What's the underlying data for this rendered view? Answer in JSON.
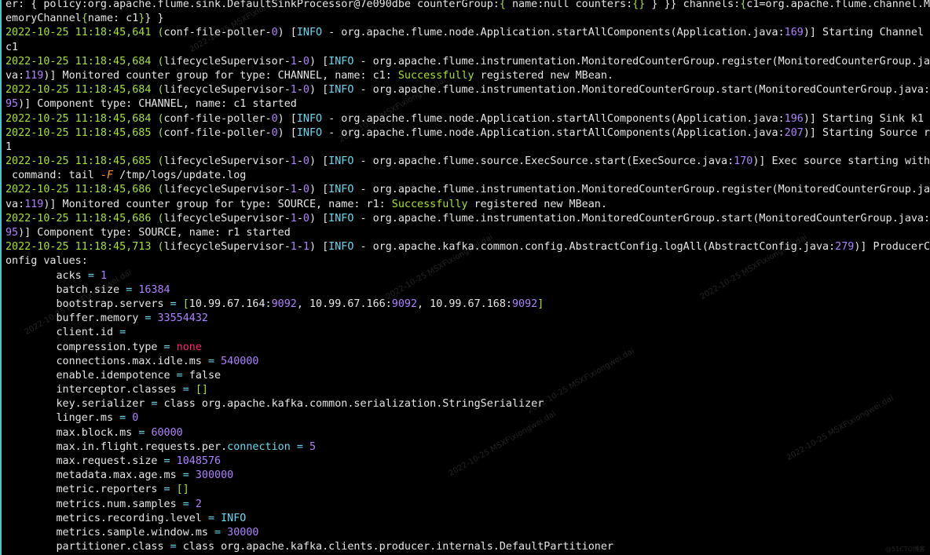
{
  "terminal": {
    "lines": [
      [
        [
          "er: { policy:org.apache.flume.sink.DefaultSinkProcessor@7e090dbe counterGroup:",
          "w"
        ],
        [
          "{",
          "g"
        ],
        [
          " name:null counters:",
          "w"
        ],
        [
          "{}",
          "g"
        ],
        [
          " } }} channels:",
          "w"
        ],
        [
          "{",
          "g"
        ],
        [
          "c1=org.apache.flume.channel.M",
          "w"
        ]
      ],
      [
        [
          "emoryChannel",
          "w"
        ],
        [
          "{",
          "g"
        ],
        [
          "name: c1",
          "w"
        ],
        [
          "}",
          "g"
        ],
        [
          "} }",
          "w"
        ]
      ],
      [
        [
          "2022-10-25 11:18:45,641 ",
          "g"
        ],
        [
          "(",
          "g"
        ],
        [
          "conf-file-poller-",
          "w"
        ],
        [
          "0",
          "p"
        ],
        [
          ") [",
          "w"
        ],
        [
          "INFO",
          "b"
        ],
        [
          " - org.apache.flume.node.Application.startAllComponents(",
          "w"
        ],
        [
          "Application.java:",
          "w"
        ],
        [
          "169",
          "p"
        ],
        [
          ")] Starting Channel",
          "w"
        ]
      ],
      [
        [
          "c1",
          "w"
        ]
      ],
      [
        [
          "2022-10-25 11:18:45,684 ",
          "g"
        ],
        [
          "(",
          "g"
        ],
        [
          "lifecycleSupervisor-",
          "w"
        ],
        [
          "1",
          "p"
        ],
        [
          "-",
          "w"
        ],
        [
          "0",
          "p"
        ],
        [
          ") [",
          "w"
        ],
        [
          "INFO",
          "b"
        ],
        [
          " - org.apache.flume.instrumentation.MonitoredCounterGroup.register(",
          "w"
        ],
        [
          "MonitoredCounterGroup.ja",
          "w"
        ]
      ],
      [
        [
          "va:",
          "w"
        ],
        [
          "119",
          "p"
        ],
        [
          ")] Monitored counter group for type: CHANNEL, name: c1: ",
          "w"
        ],
        [
          "Successfully",
          "s"
        ],
        [
          " registered new MBean.",
          "w"
        ]
      ],
      [
        [
          "2022-10-25 11:18:45,684 ",
          "g"
        ],
        [
          "(",
          "g"
        ],
        [
          "lifecycleSupervisor-",
          "w"
        ],
        [
          "1",
          "p"
        ],
        [
          "-",
          "w"
        ],
        [
          "0",
          "p"
        ],
        [
          ") [",
          "w"
        ],
        [
          "INFO",
          "b"
        ],
        [
          " - org.apache.flume.instrumentation.MonitoredCounterGroup.start(",
          "w"
        ],
        [
          "MonitoredCounterGroup.java:",
          "w"
        ]
      ],
      [
        [
          "95",
          "p"
        ],
        [
          ")] Component type: CHANNEL, name: c1 started",
          "w"
        ]
      ],
      [
        [
          "2022-10-25 11:18:45,684 ",
          "g"
        ],
        [
          "(",
          "g"
        ],
        [
          "conf-file-poller-",
          "w"
        ],
        [
          "0",
          "p"
        ],
        [
          ") [",
          "w"
        ],
        [
          "INFO",
          "b"
        ],
        [
          " - org.apache.flume.node.Application.startAllComponents(",
          "w"
        ],
        [
          "Application.java:",
          "w"
        ],
        [
          "196",
          "p"
        ],
        [
          ")] Starting Sink k1",
          "w"
        ]
      ],
      [
        [
          "2022-10-25 11:18:45,685 ",
          "g"
        ],
        [
          "(",
          "g"
        ],
        [
          "conf-file-poller-",
          "w"
        ],
        [
          "0",
          "p"
        ],
        [
          ") [",
          "w"
        ],
        [
          "INFO",
          "b"
        ],
        [
          " - org.apache.flume.node.Application.startAllComponents(",
          "w"
        ],
        [
          "Application.java:",
          "w"
        ],
        [
          "207",
          "p"
        ],
        [
          ")] Starting Source r",
          "w"
        ]
      ],
      [
        [
          "1",
          "w"
        ]
      ],
      [
        [
          "2022-10-25 11:18:45,685 ",
          "g"
        ],
        [
          "(",
          "g"
        ],
        [
          "lifecycleSupervisor-",
          "w"
        ],
        [
          "1",
          "p"
        ],
        [
          "-",
          "w"
        ],
        [
          "0",
          "p"
        ],
        [
          ") [",
          "w"
        ],
        [
          "INFO",
          "b"
        ],
        [
          " - org.apache.flume.source.ExecSource.start(",
          "w"
        ],
        [
          "ExecSource.java:",
          "w"
        ],
        [
          "170",
          "p"
        ],
        [
          ")] Exec source starting with",
          "w"
        ]
      ],
      [
        [
          " command: tail ",
          "w"
        ],
        [
          "-F",
          "o"
        ],
        [
          " /tmp/logs/update.log",
          "w"
        ]
      ],
      [
        [
          "2022-10-25 11:18:45,686 ",
          "g"
        ],
        [
          "(",
          "g"
        ],
        [
          "lifecycleSupervisor-",
          "w"
        ],
        [
          "1",
          "p"
        ],
        [
          "-",
          "w"
        ],
        [
          "0",
          "p"
        ],
        [
          ") [",
          "w"
        ],
        [
          "INFO",
          "b"
        ],
        [
          " - org.apache.flume.instrumentation.MonitoredCounterGroup.register(",
          "w"
        ],
        [
          "MonitoredCounterGroup.ja",
          "w"
        ]
      ],
      [
        [
          "va:",
          "w"
        ],
        [
          "119",
          "p"
        ],
        [
          ")] Monitored counter group for type: SOURCE, name: r1: ",
          "w"
        ],
        [
          "Successfully",
          "s"
        ],
        [
          " registered new MBean.",
          "w"
        ]
      ],
      [
        [
          "2022-10-25 11:18:45,686 ",
          "g"
        ],
        [
          "(",
          "g"
        ],
        [
          "lifecycleSupervisor-",
          "w"
        ],
        [
          "1",
          "p"
        ],
        [
          "-",
          "w"
        ],
        [
          "0",
          "p"
        ],
        [
          ") [",
          "w"
        ],
        [
          "INFO",
          "b"
        ],
        [
          " - org.apache.flume.instrumentation.MonitoredCounterGroup.start(",
          "w"
        ],
        [
          "MonitoredCounterGroup.java:",
          "w"
        ]
      ],
      [
        [
          "95",
          "p"
        ],
        [
          ")] Component type: SOURCE, name: r1 started",
          "w"
        ]
      ],
      [
        [
          "2022-10-25 11:18:45,713 ",
          "g"
        ],
        [
          "(",
          "g"
        ],
        [
          "lifecycleSupervisor-",
          "w"
        ],
        [
          "1",
          "p"
        ],
        [
          "-",
          "w"
        ],
        [
          "1",
          "p"
        ],
        [
          ") [",
          "w"
        ],
        [
          "INFO",
          "b"
        ],
        [
          " - org.apache.kafka.common.config.AbstractConfig.logAll(",
          "w"
        ],
        [
          "AbstractConfig.java:",
          "w"
        ],
        [
          "279",
          "p"
        ],
        [
          ")] ProducerC",
          "w"
        ]
      ],
      [
        [
          "onfig values:",
          "w"
        ]
      ],
      [
        [
          "        acks ",
          "w"
        ],
        [
          "=",
          "b"
        ],
        [
          " ",
          "w"
        ],
        [
          "1",
          "p"
        ]
      ],
      [
        [
          "        batch.size ",
          "w"
        ],
        [
          "=",
          "b"
        ],
        [
          " ",
          "w"
        ],
        [
          "16384",
          "p"
        ]
      ],
      [
        [
          "        bootstrap.servers ",
          "w"
        ],
        [
          "=",
          "b"
        ],
        [
          " [",
          "g"
        ],
        [
          "10.99.67.164:",
          "w"
        ],
        [
          "9092",
          "p"
        ],
        [
          ", ",
          "w"
        ],
        [
          "10.99.67.166:",
          "w"
        ],
        [
          "9092",
          "p"
        ],
        [
          ", ",
          "w"
        ],
        [
          "10.99.67.168:",
          "w"
        ],
        [
          "9092",
          "p"
        ],
        [
          "]",
          "g"
        ]
      ],
      [
        [
          "        buffer.memory ",
          "w"
        ],
        [
          "=",
          "b"
        ],
        [
          " ",
          "w"
        ],
        [
          "33554432",
          "p"
        ]
      ],
      [
        [
          "        client.id ",
          "w"
        ],
        [
          "=",
          "b"
        ]
      ],
      [
        [
          "        compression.type ",
          "w"
        ],
        [
          "=",
          "b"
        ],
        [
          " ",
          "w"
        ],
        [
          "none",
          "r"
        ]
      ],
      [
        [
          "        connections.max.idle.ms ",
          "w"
        ],
        [
          "=",
          "b"
        ],
        [
          " ",
          "w"
        ],
        [
          "540000",
          "p"
        ]
      ],
      [
        [
          "        enable.idempotence ",
          "w"
        ],
        [
          "=",
          "b"
        ],
        [
          " false",
          "w"
        ]
      ],
      [
        [
          "        interceptor.classes ",
          "w"
        ],
        [
          "=",
          "b"
        ],
        [
          " ",
          "w"
        ],
        [
          "[]",
          "g"
        ]
      ],
      [
        [
          "        key.serializer ",
          "w"
        ],
        [
          "=",
          "b"
        ],
        [
          " class org.apache.kafka.common.serialization.StringSerializer",
          "w"
        ]
      ],
      [
        [
          "        linger.ms ",
          "w"
        ],
        [
          "=",
          "b"
        ],
        [
          " ",
          "w"
        ],
        [
          "0",
          "p"
        ]
      ],
      [
        [
          "        max.block.ms ",
          "w"
        ],
        [
          "=",
          "b"
        ],
        [
          " ",
          "w"
        ],
        [
          "60000",
          "p"
        ]
      ],
      [
        [
          "        max.in.flight.requests.per.",
          "w"
        ],
        [
          "connection",
          "b"
        ],
        [
          " ",
          "w"
        ],
        [
          "=",
          "b"
        ],
        [
          " ",
          "w"
        ],
        [
          "5",
          "p"
        ]
      ],
      [
        [
          "        max.request.size ",
          "w"
        ],
        [
          "=",
          "b"
        ],
        [
          " ",
          "w"
        ],
        [
          "1048576",
          "p"
        ]
      ],
      [
        [
          "        metadata.max.age.ms ",
          "w"
        ],
        [
          "=",
          "b"
        ],
        [
          " ",
          "w"
        ],
        [
          "300000",
          "p"
        ]
      ],
      [
        [
          "        metric.reporters ",
          "w"
        ],
        [
          "=",
          "b"
        ],
        [
          " ",
          "w"
        ],
        [
          "[]",
          "g"
        ]
      ],
      [
        [
          "        metrics.num.samples ",
          "w"
        ],
        [
          "=",
          "b"
        ],
        [
          " ",
          "w"
        ],
        [
          "2",
          "p"
        ]
      ],
      [
        [
          "        metrics.recording.level ",
          "w"
        ],
        [
          "=",
          "b"
        ],
        [
          " ",
          "w"
        ],
        [
          "INFO",
          "b"
        ]
      ],
      [
        [
          "        metrics.sample.window.ms ",
          "w"
        ],
        [
          "=",
          "b"
        ],
        [
          " ",
          "w"
        ],
        [
          "30000",
          "p"
        ]
      ],
      [
        [
          "        partitioner.class ",
          "w"
        ],
        [
          "=",
          "b"
        ],
        [
          " class org.apache.kafka.clients.producer.internals.DefaultPartitioner",
          "w"
        ]
      ]
    ]
  },
  "colors": {
    "background": "#000000",
    "text": "#e6e6e6",
    "green": "#a6e22e",
    "purple": "#ae81ff",
    "blue": "#66d9ef",
    "orange": "#fd971f",
    "red": "#f92672",
    "left_border": "#4fc3c7"
  },
  "watermarks": [
    "2022-10-25  MSXF\\xiongwei.dai",
    "2022-10-25  MSXF\\xiongwei.dai",
    "2022-10-25  MSXF\\xiongwei.dai",
    "2022-10-25  MSXF\\xiongwei.dai",
    "2022-10-25  MSXF\\xiongwei.dai",
    "2022-10-25  MSXF\\xiongwei.dai",
    "2022-10-25  MSXF\\xiongwei.dai",
    "2022-10-25  MSXF\\xiongwei.dai"
  ],
  "corner_mark": "@51CTO博客"
}
